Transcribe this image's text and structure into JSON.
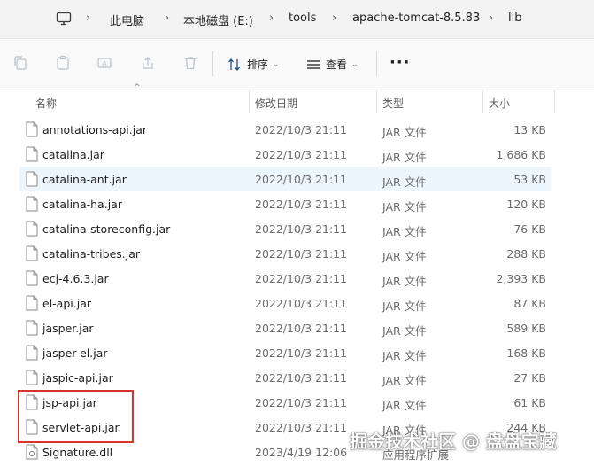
{
  "breadcrumbs": [
    "此电脑",
    "本地磁盘 (E:)",
    "tools",
    "apache-tomcat-8.5.83",
    "lib"
  ],
  "toolbar": {
    "sort_label": "排序",
    "view_label": "查看",
    "more_label": "···"
  },
  "columns": {
    "name": "名称",
    "date": "修改日期",
    "type": "类型",
    "size": "大小"
  },
  "files": [
    {
      "name": "annotations-api.jar",
      "date": "2022/10/3 21:11",
      "type": "JAR 文件",
      "size": "13 KB"
    },
    {
      "name": "catalina.jar",
      "date": "2022/10/3 21:11",
      "type": "JAR 文件",
      "size": "1,686 KB"
    },
    {
      "name": "catalina-ant.jar",
      "date": "2022/10/3 21:11",
      "type": "JAR 文件",
      "size": "53 KB"
    },
    {
      "name": "catalina-ha.jar",
      "date": "2022/10/3 21:11",
      "type": "JAR 文件",
      "size": "120 KB"
    },
    {
      "name": "catalina-storeconfig.jar",
      "date": "2022/10/3 21:11",
      "type": "JAR 文件",
      "size": "76 KB"
    },
    {
      "name": "catalina-tribes.jar",
      "date": "2022/10/3 21:11",
      "type": "JAR 文件",
      "size": "288 KB"
    },
    {
      "name": "ecj-4.6.3.jar",
      "date": "2022/10/3 21:11",
      "type": "JAR 文件",
      "size": "2,393 KB"
    },
    {
      "name": "el-api.jar",
      "date": "2022/10/3 21:11",
      "type": "JAR 文件",
      "size": "87 KB"
    },
    {
      "name": "jasper.jar",
      "date": "2022/10/3 21:11",
      "type": "JAR 文件",
      "size": "589 KB"
    },
    {
      "name": "jasper-el.jar",
      "date": "2022/10/3 21:11",
      "type": "JAR 文件",
      "size": "168 KB"
    },
    {
      "name": "jaspic-api.jar",
      "date": "2022/10/3 21:11",
      "type": "JAR 文件",
      "size": "27 KB"
    },
    {
      "name": "jsp-api.jar",
      "date": "2022/10/3 21:11",
      "type": "JAR 文件",
      "size": "61 KB"
    },
    {
      "name": "servlet-api.jar",
      "date": "2022/10/3 21:11",
      "type": "JAR 文件",
      "size": "244 KB"
    },
    {
      "name": "Signature.dll",
      "date": "2023/4/19 12:06",
      "type": "应用程序扩展",
      "size": ""
    }
  ],
  "selected_file": "catalina-ant.jar",
  "watermark": "掘金技术社区 @ 盘盘宝藏",
  "colors": {
    "selection": "#e5f1fb",
    "highlight_box": "#d9342b",
    "toolbar_accent": "#0067c0"
  }
}
